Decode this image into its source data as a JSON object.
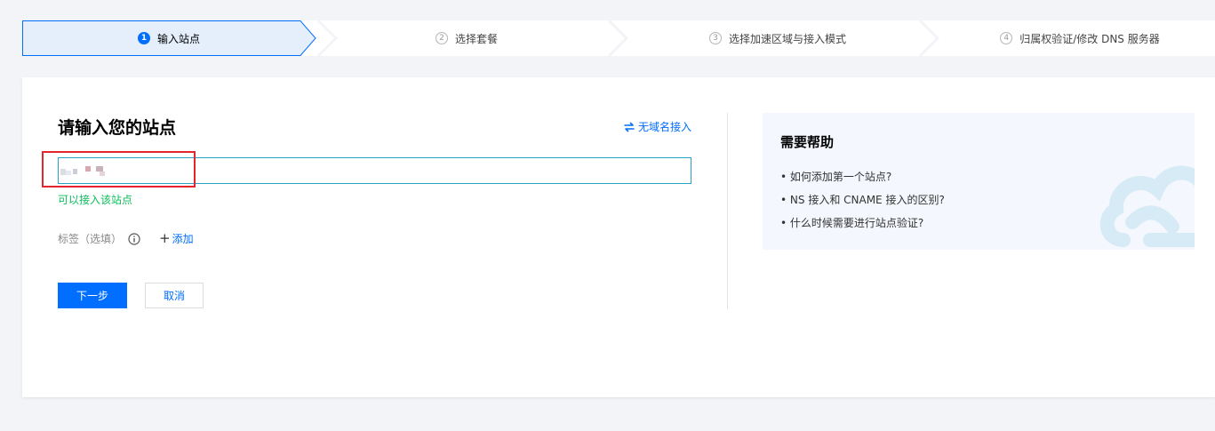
{
  "steps": [
    {
      "num": "1",
      "label": "输入站点",
      "active": true
    },
    {
      "num": "2",
      "label": "选择套餐",
      "active": false
    },
    {
      "num": "3",
      "label": "选择加速区域与接入模式",
      "active": false
    },
    {
      "num": "4",
      "label": "归属权验证/修改 DNS 服务器",
      "active": false
    }
  ],
  "form": {
    "title": "请输入您的站点",
    "no_domain_link": "无域名接入",
    "site_value_hidden": "redacted",
    "success_message": "可以接入该站点",
    "tag_label": "标签（选填）",
    "add_label": "添加",
    "next_button": "下一步",
    "cancel_button": "取消"
  },
  "help": {
    "title": "需要帮助",
    "links": [
      "如何添加第一个站点?",
      "NS 接入和 CNAME 接入的区别?",
      "什么时候需要进行站点验证?"
    ]
  },
  "colors": {
    "primary": "#006eff",
    "success": "#0abf5b",
    "highlight": "#e5242b",
    "active_step_bg": "#e5eefb"
  },
  "icons": {
    "swap": "swap-icon",
    "info": "info-icon",
    "plus": "plus-icon",
    "cloud": "cloud-logo-icon"
  }
}
